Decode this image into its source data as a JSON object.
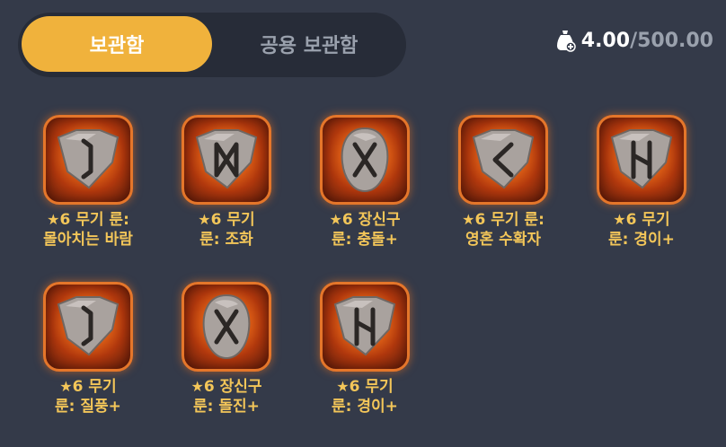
{
  "tabs": {
    "storage": "보관함",
    "shared_storage": "공용 보관함"
  },
  "weight": {
    "current": "4.00",
    "max": "/500.00"
  },
  "items": [
    {
      "grade": "6",
      "line1": "무기 룬:",
      "line2": "몰아치는 바람",
      "rune": "eihwaz",
      "shape": "shield"
    },
    {
      "grade": "6",
      "line1": "무기",
      "line2": "룬: 조화",
      "rune": "dagaz",
      "shape": "shield"
    },
    {
      "grade": "6",
      "line1": "장신구",
      "line2": "룬: 충돌+",
      "rune": "gebo",
      "shape": "oval"
    },
    {
      "grade": "6",
      "line1": "무기 룬:",
      "line2": "영혼 수확자",
      "rune": "kenaz",
      "shape": "shield"
    },
    {
      "grade": "6",
      "line1": "무기",
      "line2": "룬: 경이+",
      "rune": "hagalaz",
      "shape": "shield"
    },
    {
      "grade": "6",
      "line1": "무기",
      "line2": "룬: 질풍+",
      "rune": "eihwaz",
      "shape": "shield"
    },
    {
      "grade": "6",
      "line1": "장신구",
      "line2": "룬: 돌진+",
      "rune": "gebo",
      "shape": "oval"
    },
    {
      "grade": "6",
      "line1": "무기",
      "line2": "룬: 경이+",
      "rune": "hagalaz",
      "shape": "shield"
    }
  ]
}
